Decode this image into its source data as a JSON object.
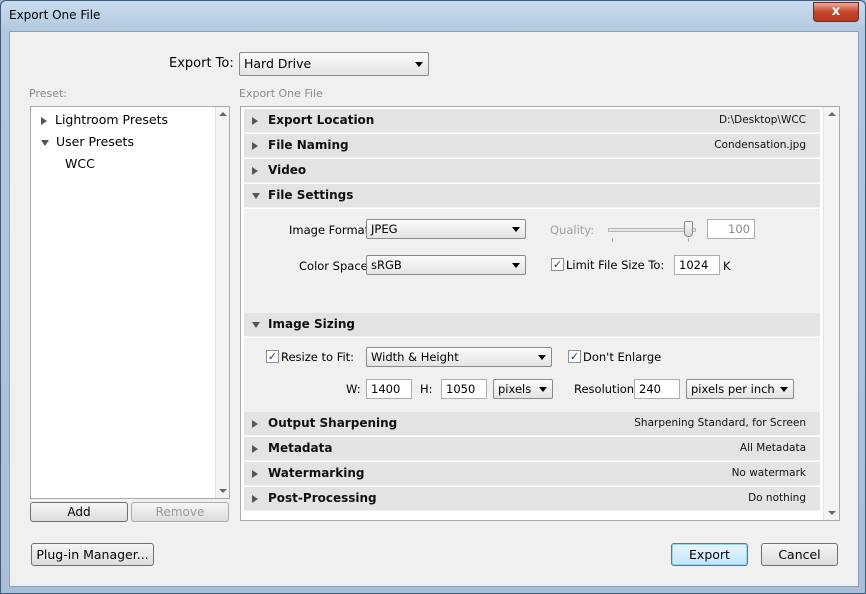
{
  "window": {
    "title": "Export One File",
    "close_glyph": "x"
  },
  "export_to": {
    "label": "Export To:",
    "value": "Hard Drive"
  },
  "preset": {
    "label": "Preset:",
    "items": [
      {
        "label": "Lightroom Presets",
        "expanded": false
      },
      {
        "label": "User Presets",
        "expanded": true
      },
      {
        "label": "WCC"
      }
    ],
    "add_label": "Add",
    "remove_label": "Remove"
  },
  "panel_label": "Export One File",
  "sections": {
    "export_location": {
      "title": "Export Location",
      "summary": "D:\\Desktop\\WCC"
    },
    "file_naming": {
      "title": "File Naming",
      "summary": "Condensation.jpg"
    },
    "video": {
      "title": "Video",
      "summary": ""
    },
    "file_settings": {
      "title": "File Settings",
      "image_format_label": "Image Format:",
      "image_format": "JPEG",
      "quality_label": "Quality:",
      "quality": "100",
      "color_space_label": "Color Space:",
      "color_space": "sRGB",
      "limit_label": "Limit File Size To:",
      "limit_checked": true,
      "limit_value": "1024",
      "limit_unit": "K"
    },
    "image_sizing": {
      "title": "Image Sizing",
      "resize_label": "Resize to Fit:",
      "resize_checked": true,
      "resize_mode": "Width & Height",
      "dont_enlarge_label": "Don't Enlarge",
      "dont_enlarge_checked": true,
      "w_label": "W:",
      "w_value": "1400",
      "h_label": "H:",
      "h_value": "1050",
      "size_unit": "pixels",
      "resolution_label": "Resolution:",
      "resolution_value": "240",
      "resolution_unit": "pixels per inch"
    },
    "output_sharpening": {
      "title": "Output Sharpening",
      "summary": "Sharpening Standard, for Screen"
    },
    "metadata": {
      "title": "Metadata",
      "summary": "All Metadata"
    },
    "watermarking": {
      "title": "Watermarking",
      "summary": "No watermark"
    },
    "post_processing": {
      "title": "Post-Processing",
      "summary": "Do nothing"
    }
  },
  "footer": {
    "plugin_label": "Plug-in Manager...",
    "export_label": "Export",
    "cancel_label": "Cancel"
  },
  "colors": {
    "section_header": "#e3e3e3",
    "close_button": "#c8452c",
    "default_button": "#bee6fd"
  }
}
